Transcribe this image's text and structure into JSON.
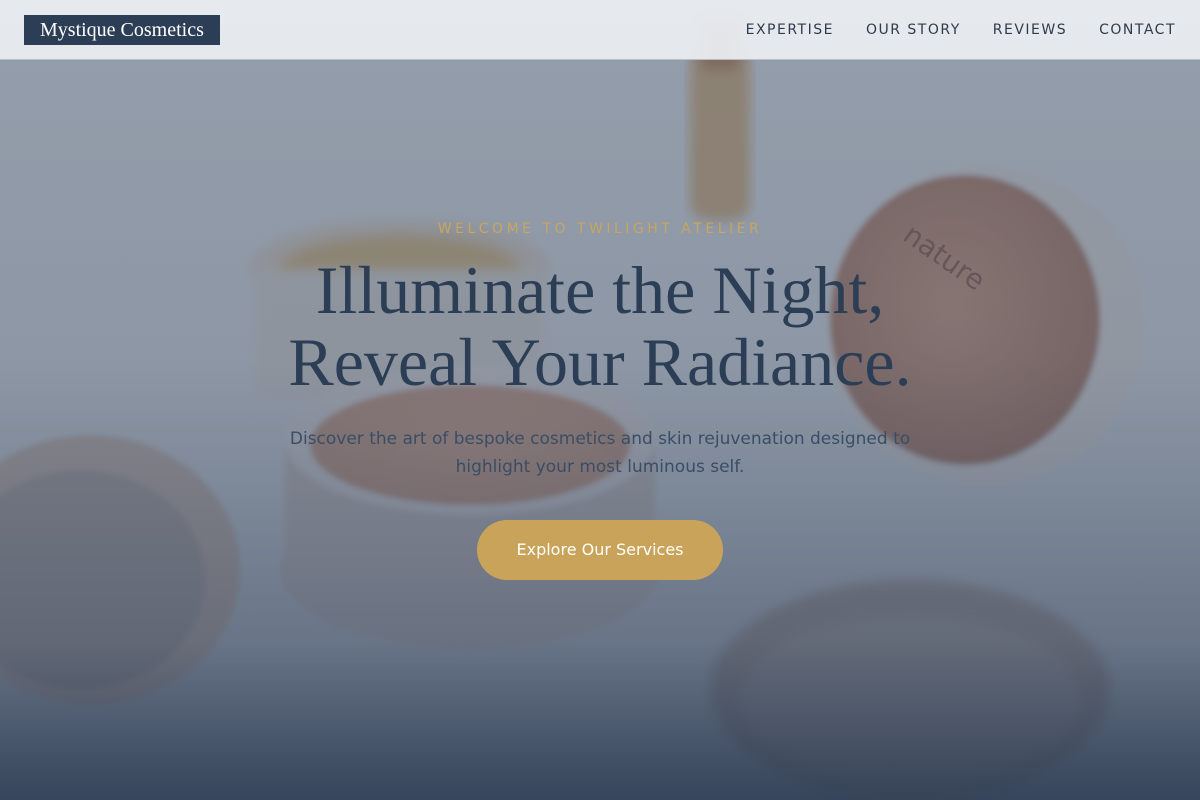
{
  "navbar": {
    "logo": "Mystique Cosmetics",
    "links": [
      {
        "label": "EXPERTISE"
      },
      {
        "label": "OUR STORY"
      },
      {
        "label": "REVIEWS"
      },
      {
        "label": "CONTACT"
      }
    ]
  },
  "hero": {
    "eyebrow": "WELCOME TO TWILIGHT ATELIER",
    "headline_line1": "Illuminate the Night,",
    "headline_line2": "Reveal Your Radiance.",
    "subtext": "Discover the art of bespoke cosmetics and skin rejuvenation designed to highlight your most luminous self.",
    "cta_label": "Explore Our Services"
  },
  "colors": {
    "navy": "#2c3e55",
    "gold": "#c9a35a",
    "nav_background": "#eceff3"
  }
}
